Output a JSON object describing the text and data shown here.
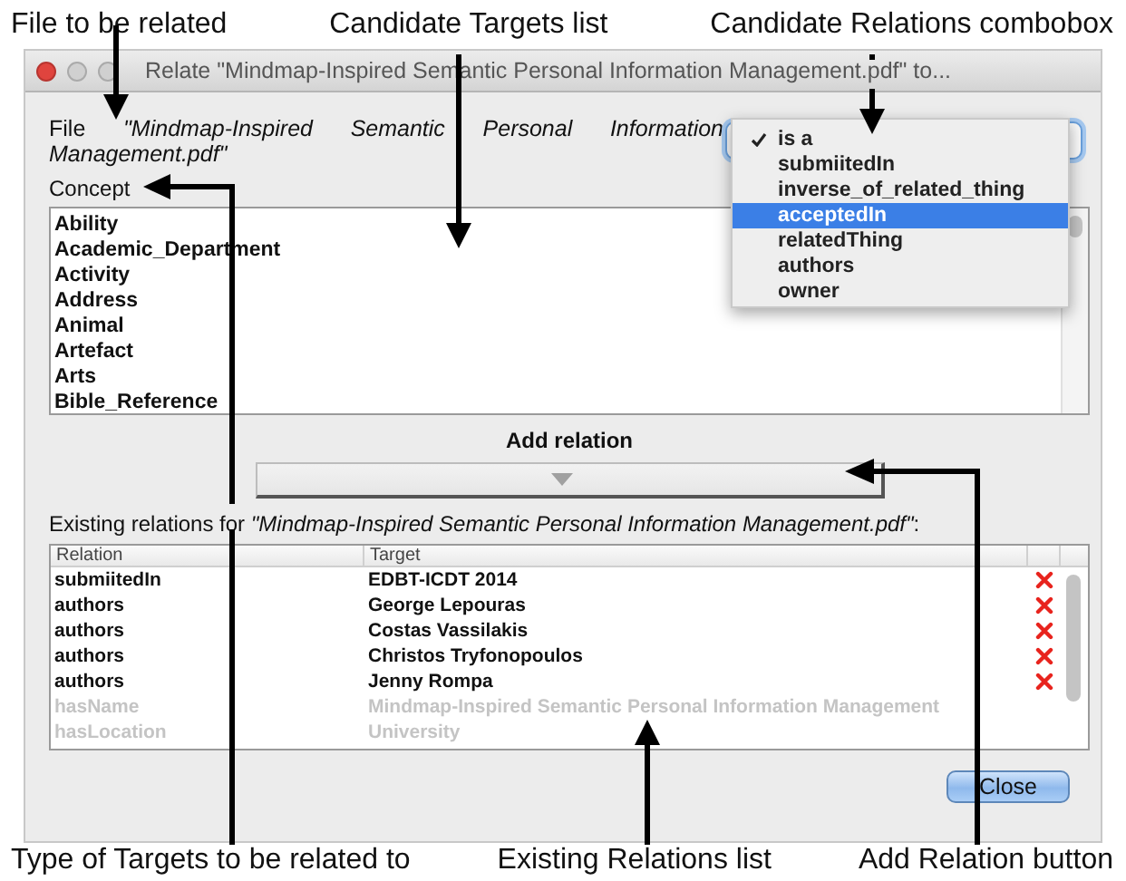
{
  "annotations": {
    "top": [
      "File to be related",
      "Candidate Targets list",
      "Candidate Relations combobox"
    ],
    "bottom": [
      "Type of Targets to be related to",
      "Existing Relations list",
      "Add Relation button"
    ]
  },
  "window": {
    "title": "Relate \"Mindmap-Inspired Semantic Personal Information Management.pdf\" to..."
  },
  "file": {
    "text": "File *\"Mindmap-Inspired Semantic Personal Information Management.pdf\"*"
  },
  "relations_popup": {
    "items": [
      {
        "label": "is a",
        "checked": true,
        "selected": false
      },
      {
        "label": "submiitedIn",
        "checked": false,
        "selected": false
      },
      {
        "label": "inverse_of_related_thing",
        "checked": false,
        "selected": false
      },
      {
        "label": "acceptedIn",
        "checked": false,
        "selected": true
      },
      {
        "label": "relatedThing",
        "checked": false,
        "selected": false
      },
      {
        "label": "authors",
        "checked": false,
        "selected": false
      },
      {
        "label": "owner",
        "checked": false,
        "selected": false
      }
    ]
  },
  "concept": {
    "label": "Concept",
    "items": [
      "Ability",
      "Academic_Department",
      "Activity",
      "Address",
      "Animal",
      "Artefact",
      "Arts",
      "Bible_Reference"
    ]
  },
  "add_relation": {
    "label": "Add relation"
  },
  "existing": {
    "label": "Existing relations for *\"Mindmap-Inspired Semantic Personal Information Management.pdf\"*:"
  },
  "table": {
    "columns": [
      "Relation",
      "Target"
    ],
    "rows": [
      {
        "relation": "submiitedIn",
        "target": "EDBT-ICDT 2014",
        "disabled": false
      },
      {
        "relation": "authors",
        "target": "George Lepouras",
        "disabled": false
      },
      {
        "relation": "authors",
        "target": "Costas Vassilakis",
        "disabled": false
      },
      {
        "relation": "authors",
        "target": "Christos Tryfonopoulos",
        "disabled": false
      },
      {
        "relation": "authors",
        "target": "Jenny Rompa",
        "disabled": false
      },
      {
        "relation": "hasName",
        "target": "Mindmap-Inspired Semantic Personal Information Management",
        "disabled": true
      },
      {
        "relation": "hasLocation",
        "target": "University",
        "disabled": true
      }
    ]
  },
  "close_button": "Close"
}
